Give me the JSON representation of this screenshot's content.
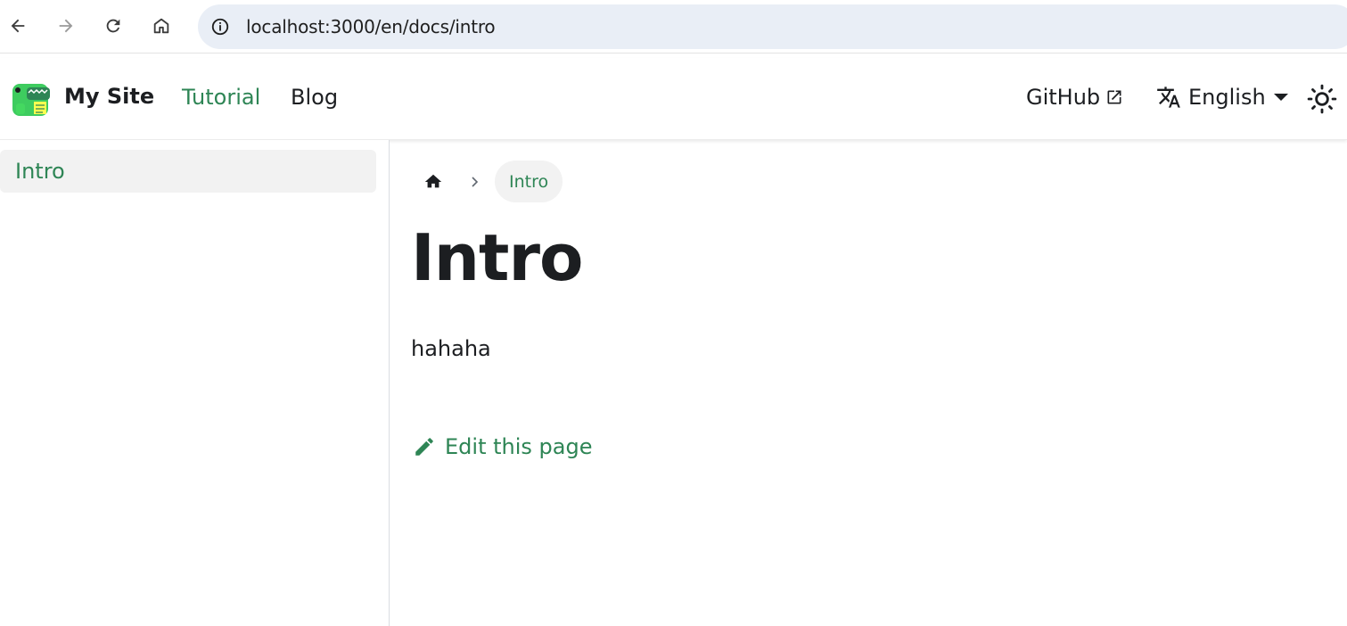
{
  "browser": {
    "url": "localhost:3000/en/docs/intro",
    "back_icon": "arrow-left-icon",
    "forward_icon": "arrow-right-icon",
    "reload_icon": "reload-icon",
    "home_icon": "home-icon",
    "info_icon": "info-icon"
  },
  "navbar": {
    "site_title": "My Site",
    "links": [
      {
        "label": "Tutorial",
        "active": true
      },
      {
        "label": "Blog",
        "active": false
      }
    ],
    "github_label": "GitHub",
    "language_label": "English"
  },
  "sidebar": {
    "items": [
      {
        "label": "Intro",
        "active": true
      }
    ]
  },
  "breadcrumb": {
    "current": "Intro"
  },
  "content": {
    "title": "Intro",
    "body": "hahaha",
    "edit_label": "Edit this page"
  },
  "colors": {
    "accent": "#2e8555",
    "text": "#1c1e21",
    "address_bar": "#e9eef6",
    "active_bg": "#f2f2f2"
  }
}
